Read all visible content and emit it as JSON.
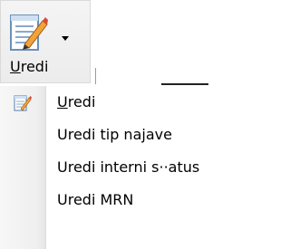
{
  "ribbon": {
    "button": {
      "label_accel": "U",
      "label_rest": "redi",
      "icon": "edit-document-icon",
      "arrow_icon": "chevron-down-icon"
    }
  },
  "menu": {
    "items": [
      {
        "accel": "U",
        "rest": "redi",
        "icon": "edit-document-icon"
      },
      {
        "label": "Uredi tip najave"
      },
      {
        "label": "Uredi interni s··atus"
      },
      {
        "label": "Uredi MRN"
      }
    ]
  }
}
